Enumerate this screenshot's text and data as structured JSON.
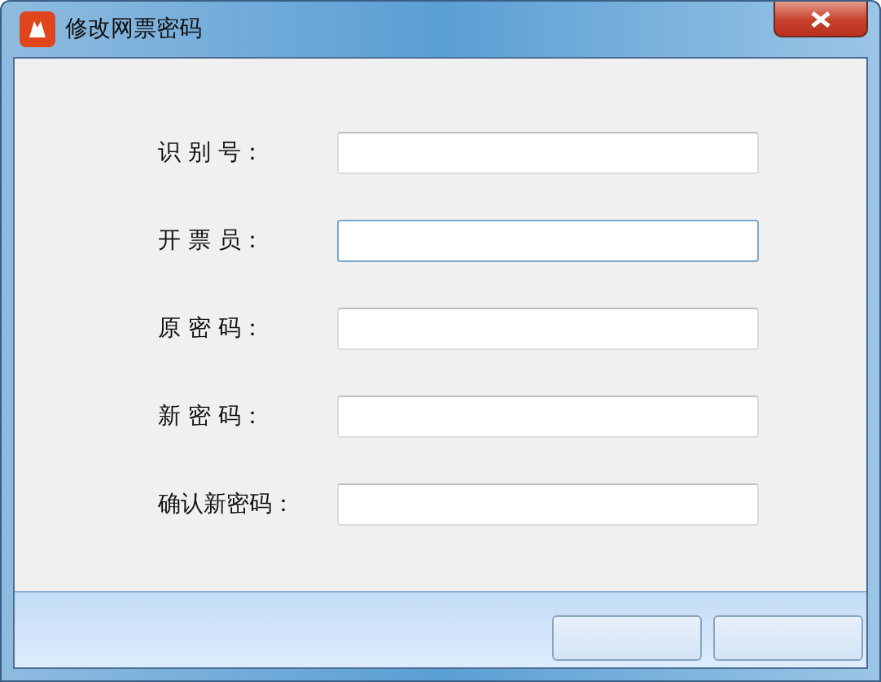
{
  "window": {
    "title": "修改网票密码"
  },
  "fields": [
    {
      "label": "识 别 号：",
      "focused": false
    },
    {
      "label": "开 票 员：",
      "focused": true
    },
    {
      "label": "原 密 码：",
      "focused": false
    },
    {
      "label": "新 密 码：",
      "focused": false
    },
    {
      "label": "确认新密码：",
      "focused": false
    }
  ],
  "buttons": [
    {
      "kind": "plain"
    },
    {
      "kind": "plain"
    }
  ]
}
